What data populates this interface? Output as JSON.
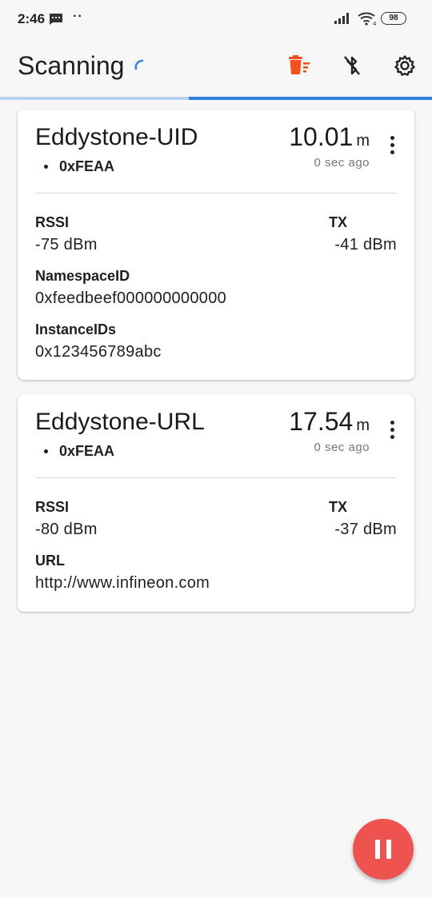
{
  "status_bar": {
    "time": "2:46",
    "battery": "98"
  },
  "app_bar": {
    "title": "Scanning"
  },
  "colors": {
    "accent": "#2f7fe0",
    "delete": "#f4511e",
    "fab": "#ef5350"
  },
  "icons": [
    "message-icon",
    "signal-icon",
    "wifi-icon",
    "battery-icon",
    "spinner-icon",
    "delete-list-icon",
    "bluetooth-disabled-icon",
    "settings-icon",
    "more-vert-icon",
    "pause-icon"
  ],
  "beacons": [
    {
      "name": "Eddystone-UID",
      "uuid": "0xFEAA",
      "distance": "10.01",
      "distance_unit": "m",
      "last_seen": "0 sec ago",
      "rssi_label": "RSSI",
      "rssi": "-75 dBm",
      "tx_label": "TX",
      "tx": "-41 dBm",
      "namespace_label": "NamespaceID",
      "namespace": "0xfeedbeef000000000000",
      "instance_label": "InstanceIDs",
      "instance": "0x123456789abc"
    },
    {
      "name": "Eddystone-URL",
      "uuid": "0xFEAA",
      "distance": "17.54",
      "distance_unit": "m",
      "last_seen": "0 sec ago",
      "rssi_label": "RSSI",
      "rssi": "-80 dBm",
      "tx_label": "TX",
      "tx": "-37 dBm",
      "url_label": "URL",
      "url": "http://www.infineon.com"
    }
  ]
}
